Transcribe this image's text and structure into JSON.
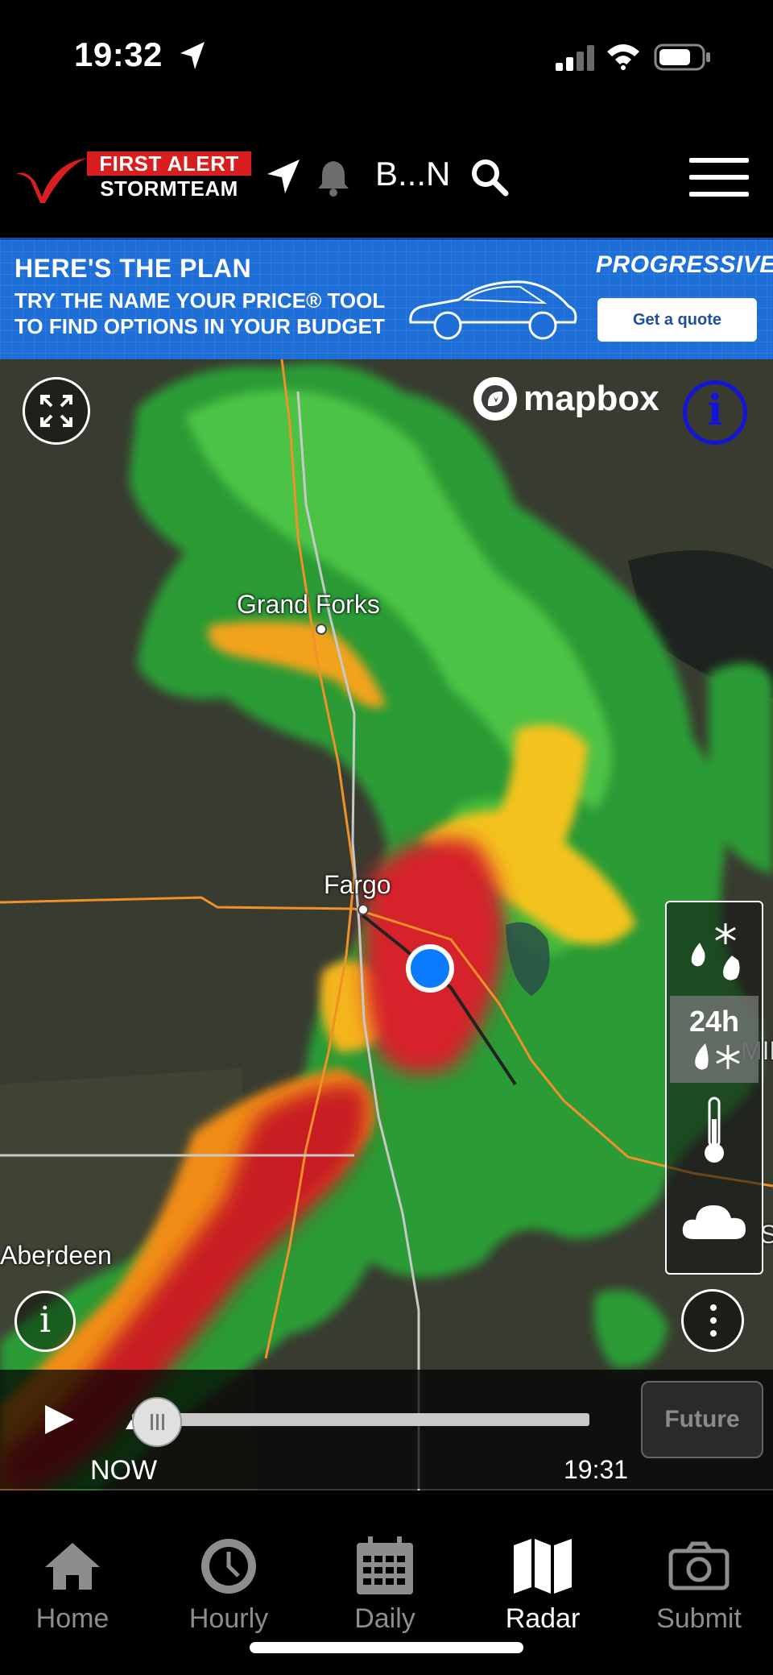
{
  "status_bar": {
    "time": "19:32"
  },
  "header": {
    "logo_line1": "FIRST ALERT",
    "logo_line2": "STORMTEAM",
    "location": "B...N"
  },
  "ad": {
    "headline": "HERE'S THE PLAN",
    "line1": "TRY THE NAME YOUR PRICE® TOOL",
    "line2": "TO FIND OPTIONS IN YOUR BUDGET",
    "brand": "PROGRESSIVE",
    "cta": "Get a quote"
  },
  "map": {
    "attribution": "mapbox",
    "info_label": "i",
    "cities": [
      "Grand Forks",
      "Fargo",
      "Aberdeen"
    ],
    "edge_labels": [
      "MIN",
      "S"
    ],
    "layers": [
      {
        "name": "precipitation",
        "icon": "rain-snow-icon"
      },
      {
        "name": "24h",
        "label": "24h",
        "icon": "rain-snow-icon"
      },
      {
        "name": "temperature",
        "icon": "thermometer-icon"
      },
      {
        "name": "clouds",
        "icon": "cloud-icon"
      }
    ]
  },
  "timeline": {
    "start_label": "NOW",
    "end_label": "19:31",
    "future_label": "Future",
    "progress": 0.05
  },
  "bottom_nav": [
    {
      "label": "Home",
      "icon": "home-icon"
    },
    {
      "label": "Hourly",
      "icon": "clock-icon"
    },
    {
      "label": "Daily",
      "icon": "calendar-icon"
    },
    {
      "label": "Radar",
      "icon": "map-icon",
      "active": true
    },
    {
      "label": "Submit",
      "icon": "camera-icon"
    }
  ],
  "colors": {
    "brand_red": "#d81e1e",
    "ad_blue": "#1d6ed6",
    "location_blue": "#0a7bff",
    "info_blue": "#1414d8"
  }
}
